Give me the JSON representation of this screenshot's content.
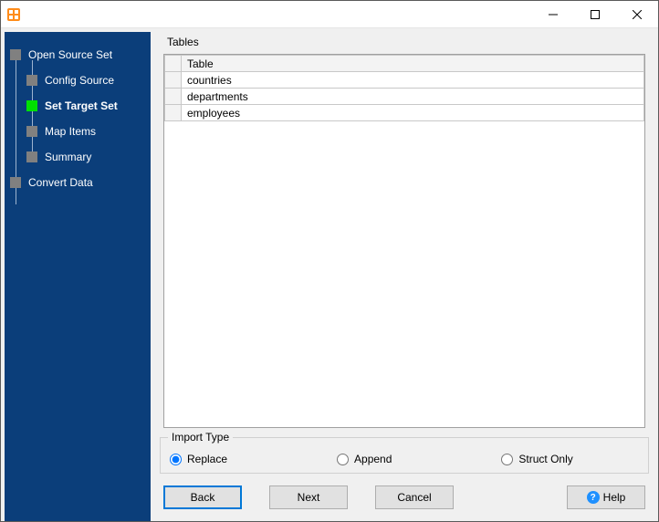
{
  "window": {
    "title": ""
  },
  "sidebar": {
    "items": [
      {
        "label": "Open Source Set",
        "active": false,
        "child": false
      },
      {
        "label": "Config Source",
        "active": false,
        "child": true
      },
      {
        "label": "Set Target Set",
        "active": true,
        "child": true
      },
      {
        "label": "Map Items",
        "active": false,
        "child": true
      },
      {
        "label": "Summary",
        "active": false,
        "child": true
      },
      {
        "label": "Convert Data",
        "active": false,
        "child": false
      }
    ]
  },
  "tables": {
    "title": "Tables",
    "header": "Table",
    "rows": [
      "countries",
      "departments",
      "employees"
    ]
  },
  "import": {
    "title": "Import Type",
    "options": [
      {
        "key": "replace",
        "label": "Replace",
        "checked": true
      },
      {
        "key": "append",
        "label": "Append",
        "checked": false
      },
      {
        "key": "struct",
        "label": "Struct Only",
        "checked": false
      }
    ]
  },
  "buttons": {
    "back": "Back",
    "next": "Next",
    "cancel": "Cancel",
    "help": "Help"
  }
}
